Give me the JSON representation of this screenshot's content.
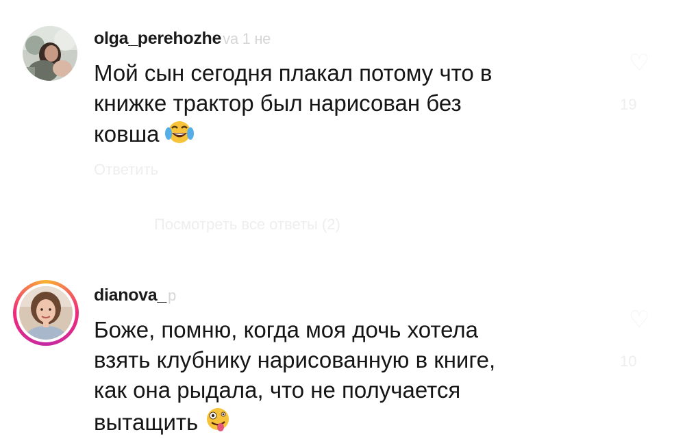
{
  "comments": [
    {
      "username": "olga_perehozhe",
      "username_faded": "va 1 не",
      "lines": [
        "Мой сын сегодня плакал потому что в",
        "книжке трактор был нарисован без",
        "ковша"
      ],
      "emoji": "face-with-tears-of-joy"
    },
    {
      "username": "dianova_",
      "username_faded": "р",
      "lines": [
        "Боже, помню, когда моя дочь хотела",
        "взять клубнику нарисованную в книге,",
        "как она рыдала, что не получается",
        "вытащить"
      ],
      "emoji": "zany-face"
    }
  ],
  "ghost": {
    "reply_label": "Ответить",
    "view_replies": "Посмотреть все ответы (2)",
    "count_1": "19",
    "count_2": "10"
  },
  "icons": [
    "heart-icon",
    "face-with-tears-of-joy-emoji",
    "zany-face-emoji",
    "avatar"
  ]
}
